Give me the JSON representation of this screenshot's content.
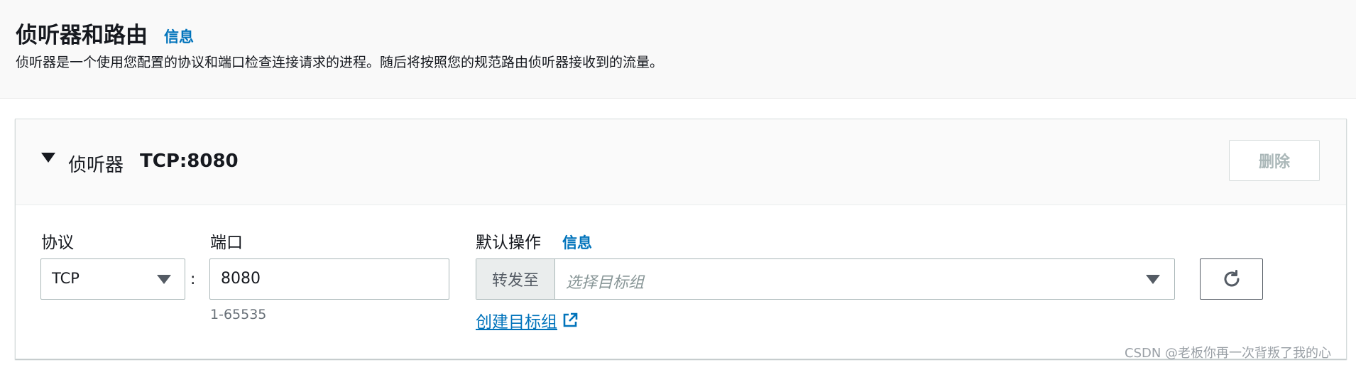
{
  "section": {
    "title": "侦听器和路由",
    "info_link": "信息",
    "description": "侦听器是一个使用您配置的协议和端口检查连接请求的进程。随后将按照您的规范路由侦听器接收到的流量。"
  },
  "listener": {
    "label": "侦听器",
    "value": "TCP:8080",
    "delete_label": "删除",
    "protocol": {
      "label": "协议",
      "selected": "TCP"
    },
    "separator": ":",
    "port": {
      "label": "端口",
      "value": "8080",
      "hint": "1-65535"
    },
    "default_action": {
      "label": "默认操作",
      "info_link": "信息",
      "prefix": "转发至",
      "placeholder": "选择目标组",
      "create_link": "创建目标组"
    }
  },
  "watermark": "CSDN @老板你再一次背叛了我的心",
  "icons": [
    "caret-down-icon",
    "chevron-down-icon",
    "refresh-icon",
    "external-link-icon"
  ],
  "colors": {
    "link": "#0073bb",
    "text": "#16191f",
    "muted": "#687078",
    "disabled": "#aab7b8"
  }
}
